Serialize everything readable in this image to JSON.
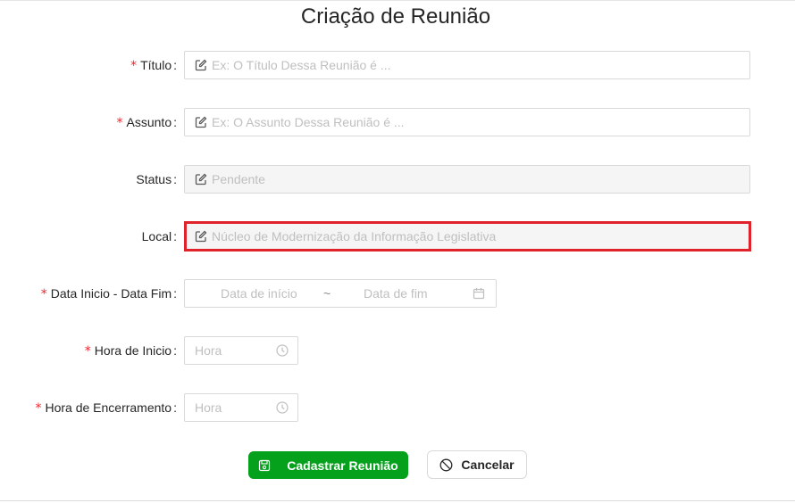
{
  "title": "Criação de Reunião",
  "fields": {
    "titulo": {
      "required_mark": "*",
      "label": "Título",
      "colon": ":",
      "placeholder": "Ex: O Título Dessa Reunião é ..."
    },
    "assunto": {
      "required_mark": "*",
      "label": "Assunto",
      "colon": ":",
      "placeholder": "Ex: O Assunto Dessa Reunião é ..."
    },
    "status": {
      "label": "Status",
      "colon": ":",
      "value": "Pendente"
    },
    "local": {
      "label": "Local",
      "colon": ":",
      "value": "Núcleo de Modernização da Informação Legislativa"
    },
    "data": {
      "required_mark": "*",
      "label": "Data Inicio - Data Fim",
      "colon": ":",
      "start_placeholder": "Data de início",
      "separator": "~",
      "end_placeholder": "Data de fim"
    },
    "hora_inicio": {
      "required_mark": "*",
      "label": "Hora de Inicio",
      "colon": ":",
      "placeholder": "Hora"
    },
    "hora_encerramento": {
      "required_mark": "*",
      "label": "Hora de Encerramento",
      "colon": ":",
      "placeholder": "Hora"
    }
  },
  "buttons": {
    "submit": "Cadastrar Reunião",
    "cancel": "Cancelar"
  },
  "colors": {
    "primary_button": "#06a11c",
    "required": "#f5222d",
    "highlight_border": "#e0222b"
  },
  "icons": {
    "edit": "edit-icon",
    "calendar": "calendar-icon",
    "clock": "clock-icon",
    "save": "save-icon",
    "cancel": "stop-icon"
  }
}
